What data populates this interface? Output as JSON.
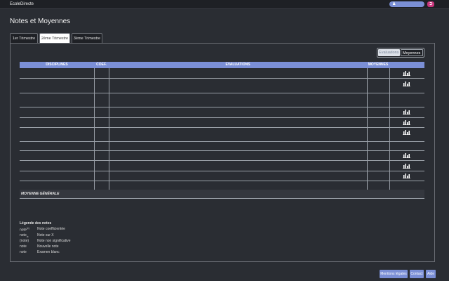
{
  "topbar": {
    "brand": "EcoleDirecte",
    "user_icon": "user-icon",
    "logout_icon": "logout-icon",
    "accent": "#7b8fd6",
    "logout_color": "#c9367d"
  },
  "page": {
    "title": "Notes et Moyennes"
  },
  "tabs": [
    {
      "label": "1er Trimestre",
      "active": false
    },
    {
      "label": "2ème Trimestre",
      "active": true
    },
    {
      "label": "3ème Trimestre",
      "active": false
    }
  ],
  "view_toggle": {
    "evaluations": "Evaluations",
    "moyennes": "Moyennes",
    "selected": "Moyennes"
  },
  "table": {
    "headers": {
      "disciplines": "DISCIPLINES",
      "coef": "COEF.",
      "evaluations": "EVALUATIONS",
      "moyennes": "MOYENNES"
    },
    "footer_label": "MOYENNE GÉNÉRALE",
    "chart_icon": "bar-chart-icon"
  },
  "legend": {
    "title": "Légende des notes",
    "items": [
      {
        "key": "note",
        "mark": "(x)",
        "mark_type": "sup",
        "desc": "Note coefficientée"
      },
      {
        "key": "note",
        "mark": "/x",
        "mark_type": "sub",
        "desc": "Note sur X"
      },
      {
        "key": "(note)",
        "mark": "",
        "mark_type": "none",
        "desc": "Note non significative"
      },
      {
        "key": "note",
        "mark": "",
        "mark_type": "none",
        "desc": "Nouvelle note"
      },
      {
        "key": "note",
        "mark": "",
        "mark_type": "none",
        "desc": "Examen blanc"
      }
    ]
  },
  "footer": {
    "mentions": "Mentions légales",
    "contact": "Contact",
    "aide": "Aide"
  }
}
